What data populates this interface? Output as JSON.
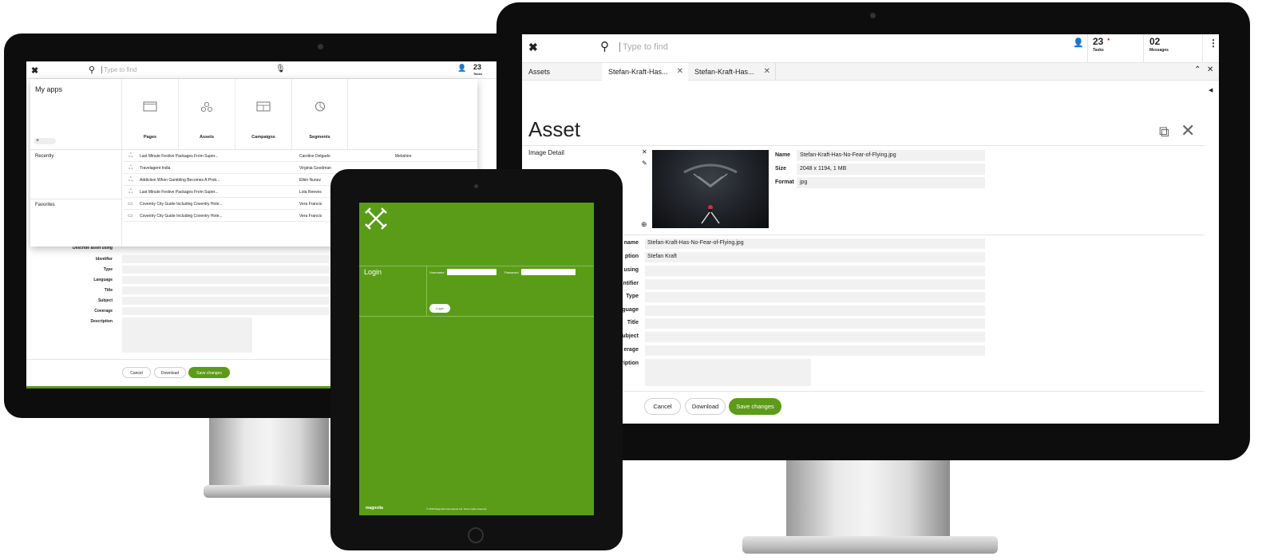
{
  "brand": {
    "accent": "#5c9b19",
    "accent_dark": "#4a8a10"
  },
  "left_monitor": {
    "search_placeholder": "Type to find",
    "tasks_count": "23",
    "tasks_label": "Tasks",
    "my_apps_title": "My apps",
    "add_label": "+",
    "apps": [
      {
        "label": "Pages",
        "icon": "page-icon"
      },
      {
        "label": "Assets",
        "icon": "assets-icon"
      },
      {
        "label": "Campaigns",
        "icon": "campaigns-icon"
      },
      {
        "label": "Segments",
        "icon": "segments-icon"
      }
    ],
    "recently_label": "Recently",
    "favorites_label": "Favorites",
    "recent_items": [
      {
        "title": "Last Minute Festive Packages From Super...",
        "author": "Caroline Delgado",
        "extra": "Mebshire"
      },
      {
        "title": "Travelagent India",
        "author": "Virginia Goodman",
        "extra": ""
      },
      {
        "title": "Addiction When Gambling Becomes A Prob...",
        "author": "Elbin Nunez",
        "extra": ""
      },
      {
        "title": "Last Minute Festive Packages From Super...",
        "author": "Lola Reeves",
        "extra": ""
      },
      {
        "title": "Coventry City Guide Including Coventry Hote...",
        "author": "Vera Francis",
        "extra": ""
      },
      {
        "title": "Coventry City Guide Including Coventry Hote...",
        "author": "Vera Francis",
        "extra": ""
      }
    ],
    "form_labels": [
      "Identifier",
      "Type",
      "Language",
      "Title",
      "Subject",
      "Coverage",
      "Description"
    ],
    "cut_label": "Describe asset using",
    "buttons": {
      "cancel": "Cancel",
      "download": "Download",
      "save": "Save changes"
    }
  },
  "right_monitor": {
    "search_placeholder": "Type to find",
    "tasks_count": "23",
    "tasks_label": "Tasks",
    "messages_count": "02",
    "messages_label": "Messages",
    "tabs": [
      {
        "label": "Assets"
      },
      {
        "label": "Stefan-Kraft-Has..."
      },
      {
        "label": "Stefan-Kraft-Has..."
      }
    ],
    "page_title": "Asset",
    "image_detail_label": "Image Detail",
    "meta": [
      {
        "key": "Name",
        "value": "Stefan-Kraft-Has-No-Fear-of-Flying.jpg"
      },
      {
        "key": "Size",
        "value": "2048 x 1194, 1 MB"
      },
      {
        "key": "Format",
        "value": "jpg"
      }
    ],
    "form_fields": [
      {
        "label": "name",
        "value": "Stefan-Kraft-Has-No-Fear-of-Flying.jpg"
      },
      {
        "label": "ption",
        "value": "Stefan Kraft"
      },
      {
        "label": "using",
        "value": ""
      },
      {
        "label": "ntifier",
        "value": ""
      },
      {
        "label": "Type",
        "value": ""
      },
      {
        "label": "guage",
        "value": ""
      },
      {
        "label": "Title",
        "value": ""
      },
      {
        "label": "ubject",
        "value": ""
      },
      {
        "label": "erage",
        "value": ""
      },
      {
        "label": "ription",
        "value": ""
      }
    ],
    "buttons": {
      "cancel": "Cancel",
      "download": "Download",
      "save": "Save changes"
    }
  },
  "tablet": {
    "login_heading": "Login",
    "username_label": "Username",
    "password_label": "Password",
    "password_value": "●●●●●",
    "login_button": "Login",
    "footer_brand": "magnolia",
    "footer_text": "© 2018 Magnolia International Ltd. Some rights reserved."
  }
}
